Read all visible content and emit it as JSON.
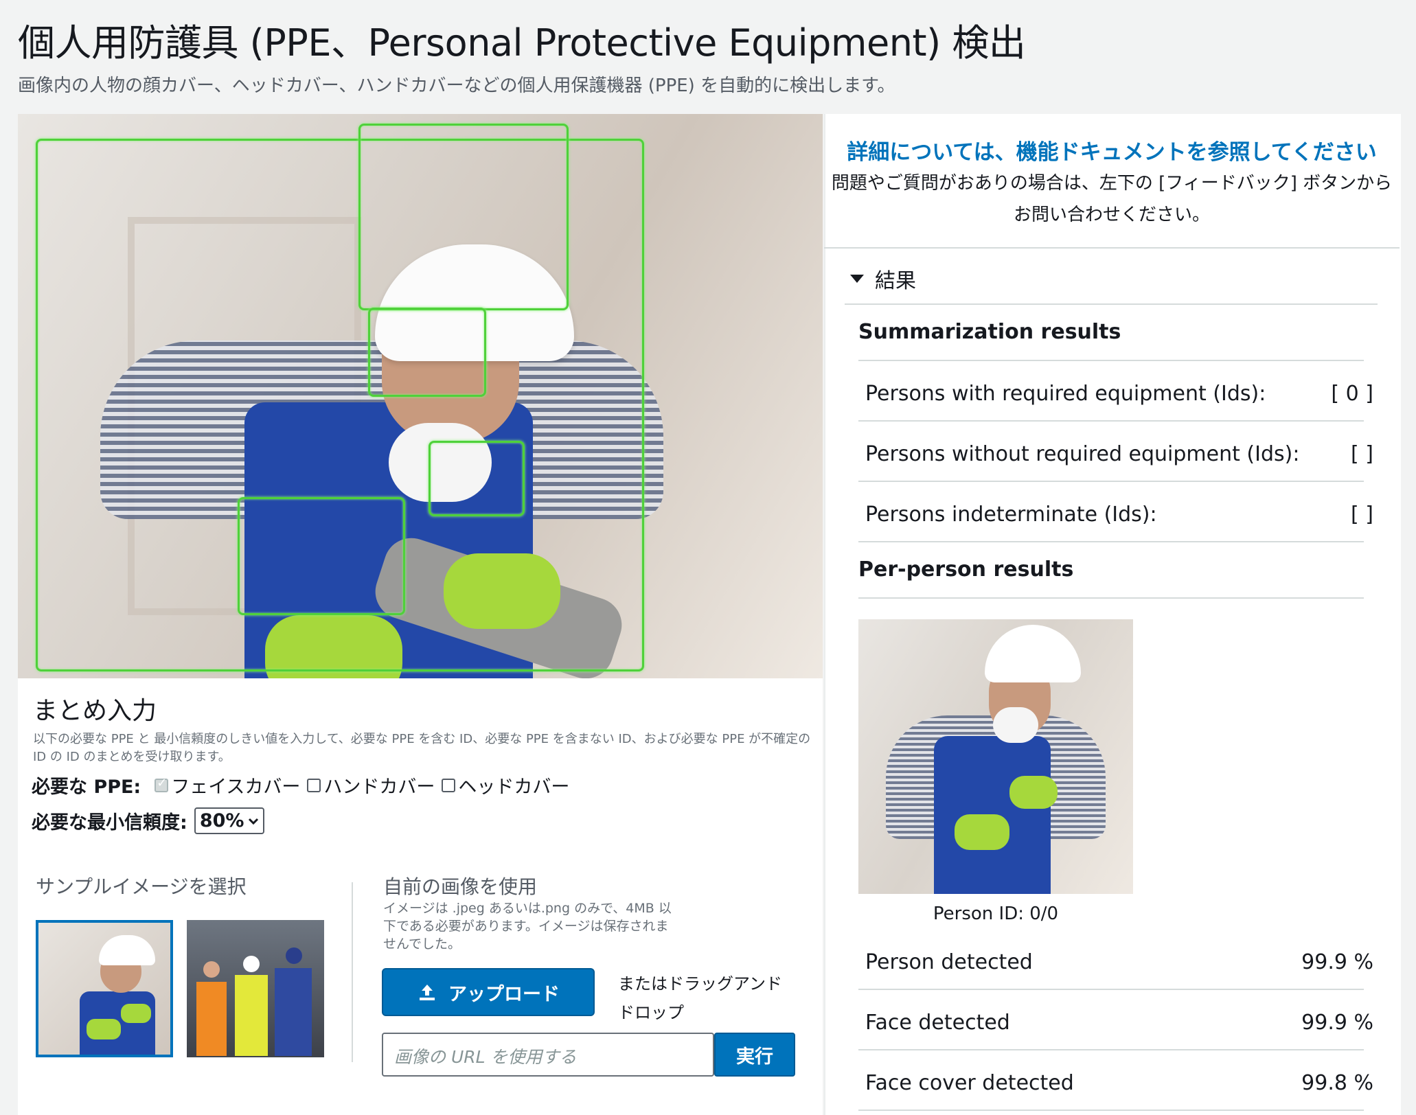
{
  "header": {
    "title": "個人用防護具 (PPE、Personal Protective Equipment) 検出",
    "subtitle": "画像内の人物の顔カバー、ヘッドカバー、ハンドカバーなどの個人用保護機器 (PPE) を自動的に検出します。"
  },
  "summary_input": {
    "heading": "まとめ入力",
    "description": "以下の必要な PPE と 最小信頼度のしきい値を入力して、必要な PPE を含む ID、必要な PPE を含まない ID、および必要な PPE が不確定の ID の ID のまとめを受け取ります。",
    "required_ppe_label": "必要な PPE:",
    "ppe_options": [
      {
        "label": "フェイスカバー",
        "checked": true,
        "disabled": true
      },
      {
        "label": "ハンドカバー",
        "checked": false
      },
      {
        "label": "ヘッドカバー",
        "checked": false
      }
    ],
    "min_confidence_label": "必要な最小信頼度:",
    "min_confidence_value": "80%"
  },
  "sample": {
    "heading": "サンプルイメージを選択"
  },
  "own_image": {
    "heading": "自前の画像を使用",
    "note": "イメージは .jpeg あるいは.png のみで、4MB 以下である必要があります。イメージは保存されませんでした。",
    "upload_label": "アップロード",
    "drag_text": "またはドラッグアンド ドロップ",
    "url_placeholder": "画像の URL を使用する",
    "run_label": "実行"
  },
  "right": {
    "doc_link": "詳細については、機能ドキュメントを参照してください",
    "doc_note": "問題やご質問がおありの場合は、左下の [フィードバック] ボタンからお問い合わせください。",
    "results_label": "結果",
    "summarization_heading": "Summarization results",
    "summary_rows": [
      {
        "label": "Persons with required equipment (Ids):",
        "value": "[ 0 ]"
      },
      {
        "label": "Persons without required equipment (Ids):",
        "value": "[ ]"
      },
      {
        "label": "Persons indeterminate (Ids):",
        "value": "[ ]"
      }
    ],
    "per_person_heading": "Per-person results",
    "person_id": "Person ID: 0/0",
    "detections": [
      {
        "label": "Person detected",
        "value": "99.9 %"
      },
      {
        "label": "Face detected",
        "value": "99.9 %"
      },
      {
        "label": "Face cover detected",
        "value": "99.8 %"
      }
    ]
  },
  "colors": {
    "accent": "#0073bb",
    "bbox": "#4fd13a",
    "glove": "#a6d83c"
  }
}
